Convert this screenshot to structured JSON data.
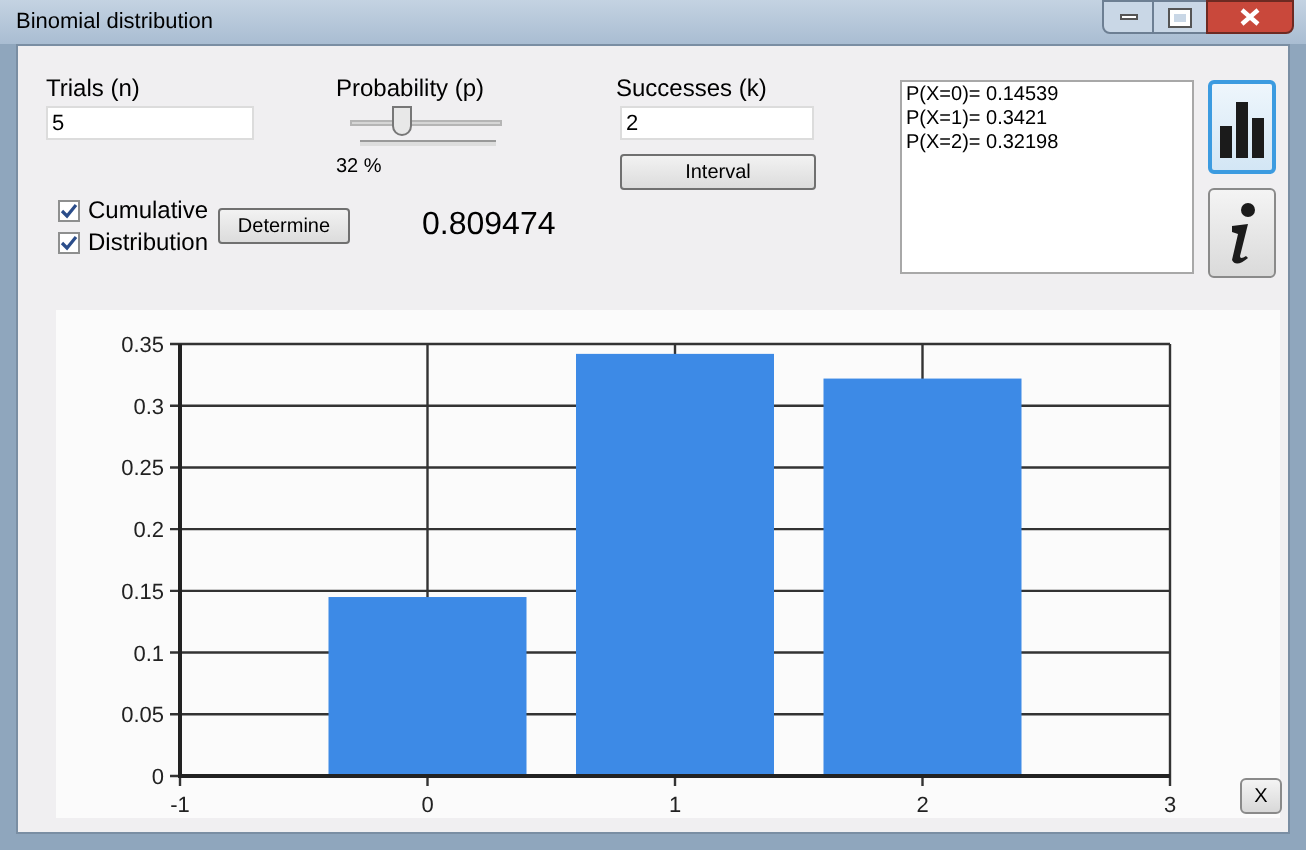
{
  "window": {
    "title": "Binomial distribution"
  },
  "trials": {
    "label": "Trials (n)",
    "value": "5"
  },
  "probability": {
    "label": "Probability (p)",
    "level": 0.32,
    "reading": "32 %"
  },
  "successes": {
    "label": "Successes (k)",
    "value": "2"
  },
  "interval_button": "Interval",
  "options": [
    {
      "label": "Cumulative",
      "checked": true
    },
    {
      "label": "Distribution",
      "checked": true
    }
  ],
  "determine_button": "Determine",
  "result": "0.809474",
  "output_lines": [
    "P(X=0)= 0.14539",
    "P(X=1)= 0.3421",
    "P(X=2)= 0.32198"
  ],
  "side_buttons": [
    {
      "kind": "chart",
      "selected": true
    },
    {
      "kind": "info",
      "selected": false
    }
  ],
  "chart": {
    "chart_data": {
      "type": "bar",
      "x": [
        0,
        1,
        2
      ],
      "values": [
        0.145,
        0.342,
        0.322
      ],
      "grid": true,
      "xlim": [
        -1,
        3
      ],
      "ylim": [
        0,
        0.35
      ],
      "xticks": [
        -1,
        0,
        1,
        2,
        3
      ],
      "yticks": [
        0,
        0.05,
        0.1,
        0.15,
        0.2,
        0.25,
        0.3,
        0.35
      ]
    }
  },
  "close_button": "X"
}
